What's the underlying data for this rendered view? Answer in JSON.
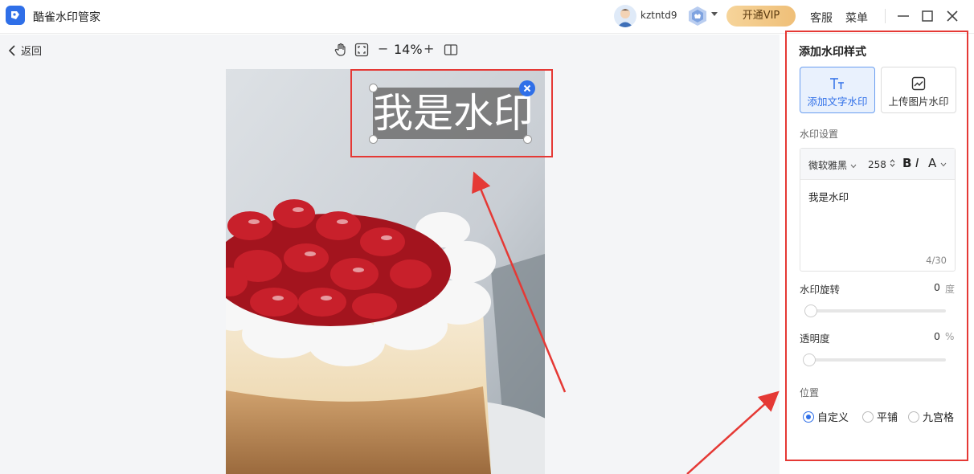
{
  "app": {
    "title": "酷雀水印管家"
  },
  "header": {
    "username": "kztntd9",
    "vip_label": "开通VIP",
    "service_label": "客服",
    "menu_label": "菜单"
  },
  "toolbar": {
    "back_label": "返回",
    "zoom_level": "14%",
    "zoom_minus": "−",
    "zoom_plus": "+"
  },
  "canvas": {
    "watermark_text": "我是水印"
  },
  "panel": {
    "title": "添加水印样式",
    "add_text_label": "添加文字水印",
    "upload_image_label": "上传图片水印",
    "settings_label": "水印设置",
    "font_family": "微软雅黑",
    "font_size": "258",
    "bold_label": "B",
    "italic_label": "I",
    "color_label": "A",
    "text_value": "我是水印",
    "char_count": "4/30",
    "rotation_label": "水印旋转",
    "rotation_value": "0",
    "rotation_unit": "度",
    "opacity_label": "透明度",
    "opacity_value": "0",
    "opacity_unit": "%",
    "position_label": "位置",
    "position_options": [
      "自定义",
      "平铺",
      "九宫格"
    ],
    "position_selected": "自定义"
  },
  "colors": {
    "accent": "#2f6fe8",
    "vip_gold": "#efbf78",
    "annotation_red": "#e53935"
  },
  "icons": [
    "app-logo-icon",
    "avatar-icon",
    "badge-icon",
    "minimize-icon",
    "maximize-icon",
    "close-icon",
    "back-chevron-icon",
    "hand-icon",
    "fit-screen-icon",
    "compare-icon",
    "text-type-icon",
    "image-upload-icon"
  ]
}
